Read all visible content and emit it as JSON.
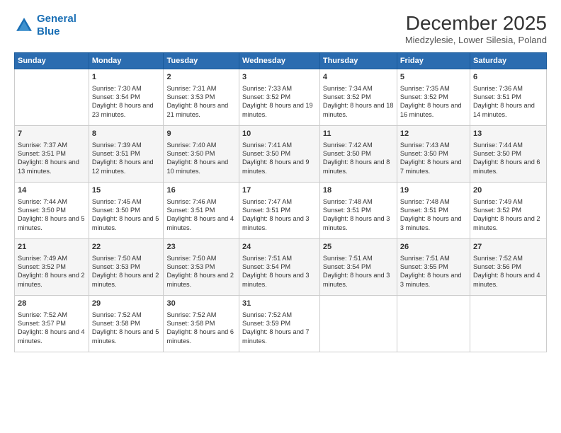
{
  "logo": {
    "line1": "General",
    "line2": "Blue"
  },
  "title": "December 2025",
  "subtitle": "Miedzylesie, Lower Silesia, Poland",
  "weekdays": [
    "Sunday",
    "Monday",
    "Tuesday",
    "Wednesday",
    "Thursday",
    "Friday",
    "Saturday"
  ],
  "weeks": [
    [
      {
        "day": "",
        "sunrise": "",
        "sunset": "",
        "daylight": ""
      },
      {
        "day": "1",
        "sunrise": "Sunrise: 7:30 AM",
        "sunset": "Sunset: 3:54 PM",
        "daylight": "Daylight: 8 hours and 23 minutes."
      },
      {
        "day": "2",
        "sunrise": "Sunrise: 7:31 AM",
        "sunset": "Sunset: 3:53 PM",
        "daylight": "Daylight: 8 hours and 21 minutes."
      },
      {
        "day": "3",
        "sunrise": "Sunrise: 7:33 AM",
        "sunset": "Sunset: 3:52 PM",
        "daylight": "Daylight: 8 hours and 19 minutes."
      },
      {
        "day": "4",
        "sunrise": "Sunrise: 7:34 AM",
        "sunset": "Sunset: 3:52 PM",
        "daylight": "Daylight: 8 hours and 18 minutes."
      },
      {
        "day": "5",
        "sunrise": "Sunrise: 7:35 AM",
        "sunset": "Sunset: 3:52 PM",
        "daylight": "Daylight: 8 hours and 16 minutes."
      },
      {
        "day": "6",
        "sunrise": "Sunrise: 7:36 AM",
        "sunset": "Sunset: 3:51 PM",
        "daylight": "Daylight: 8 hours and 14 minutes."
      }
    ],
    [
      {
        "day": "7",
        "sunrise": "Sunrise: 7:37 AM",
        "sunset": "Sunset: 3:51 PM",
        "daylight": "Daylight: 8 hours and 13 minutes."
      },
      {
        "day": "8",
        "sunrise": "Sunrise: 7:39 AM",
        "sunset": "Sunset: 3:51 PM",
        "daylight": "Daylight: 8 hours and 12 minutes."
      },
      {
        "day": "9",
        "sunrise": "Sunrise: 7:40 AM",
        "sunset": "Sunset: 3:50 PM",
        "daylight": "Daylight: 8 hours and 10 minutes."
      },
      {
        "day": "10",
        "sunrise": "Sunrise: 7:41 AM",
        "sunset": "Sunset: 3:50 PM",
        "daylight": "Daylight: 8 hours and 9 minutes."
      },
      {
        "day": "11",
        "sunrise": "Sunrise: 7:42 AM",
        "sunset": "Sunset: 3:50 PM",
        "daylight": "Daylight: 8 hours and 8 minutes."
      },
      {
        "day": "12",
        "sunrise": "Sunrise: 7:43 AM",
        "sunset": "Sunset: 3:50 PM",
        "daylight": "Daylight: 8 hours and 7 minutes."
      },
      {
        "day": "13",
        "sunrise": "Sunrise: 7:44 AM",
        "sunset": "Sunset: 3:50 PM",
        "daylight": "Daylight: 8 hours and 6 minutes."
      }
    ],
    [
      {
        "day": "14",
        "sunrise": "Sunrise: 7:44 AM",
        "sunset": "Sunset: 3:50 PM",
        "daylight": "Daylight: 8 hours and 5 minutes."
      },
      {
        "day": "15",
        "sunrise": "Sunrise: 7:45 AM",
        "sunset": "Sunset: 3:50 PM",
        "daylight": "Daylight: 8 hours and 5 minutes."
      },
      {
        "day": "16",
        "sunrise": "Sunrise: 7:46 AM",
        "sunset": "Sunset: 3:51 PM",
        "daylight": "Daylight: 8 hours and 4 minutes."
      },
      {
        "day": "17",
        "sunrise": "Sunrise: 7:47 AM",
        "sunset": "Sunset: 3:51 PM",
        "daylight": "Daylight: 8 hours and 3 minutes."
      },
      {
        "day": "18",
        "sunrise": "Sunrise: 7:48 AM",
        "sunset": "Sunset: 3:51 PM",
        "daylight": "Daylight: 8 hours and 3 minutes."
      },
      {
        "day": "19",
        "sunrise": "Sunrise: 7:48 AM",
        "sunset": "Sunset: 3:51 PM",
        "daylight": "Daylight: 8 hours and 3 minutes."
      },
      {
        "day": "20",
        "sunrise": "Sunrise: 7:49 AM",
        "sunset": "Sunset: 3:52 PM",
        "daylight": "Daylight: 8 hours and 2 minutes."
      }
    ],
    [
      {
        "day": "21",
        "sunrise": "Sunrise: 7:49 AM",
        "sunset": "Sunset: 3:52 PM",
        "daylight": "Daylight: 8 hours and 2 minutes."
      },
      {
        "day": "22",
        "sunrise": "Sunrise: 7:50 AM",
        "sunset": "Sunset: 3:53 PM",
        "daylight": "Daylight: 8 hours and 2 minutes."
      },
      {
        "day": "23",
        "sunrise": "Sunrise: 7:50 AM",
        "sunset": "Sunset: 3:53 PM",
        "daylight": "Daylight: 8 hours and 2 minutes."
      },
      {
        "day": "24",
        "sunrise": "Sunrise: 7:51 AM",
        "sunset": "Sunset: 3:54 PM",
        "daylight": "Daylight: 8 hours and 3 minutes."
      },
      {
        "day": "25",
        "sunrise": "Sunrise: 7:51 AM",
        "sunset": "Sunset: 3:54 PM",
        "daylight": "Daylight: 8 hours and 3 minutes."
      },
      {
        "day": "26",
        "sunrise": "Sunrise: 7:51 AM",
        "sunset": "Sunset: 3:55 PM",
        "daylight": "Daylight: 8 hours and 3 minutes."
      },
      {
        "day": "27",
        "sunrise": "Sunrise: 7:52 AM",
        "sunset": "Sunset: 3:56 PM",
        "daylight": "Daylight: 8 hours and 4 minutes."
      }
    ],
    [
      {
        "day": "28",
        "sunrise": "Sunrise: 7:52 AM",
        "sunset": "Sunset: 3:57 PM",
        "daylight": "Daylight: 8 hours and 4 minutes."
      },
      {
        "day": "29",
        "sunrise": "Sunrise: 7:52 AM",
        "sunset": "Sunset: 3:58 PM",
        "daylight": "Daylight: 8 hours and 5 minutes."
      },
      {
        "day": "30",
        "sunrise": "Sunrise: 7:52 AM",
        "sunset": "Sunset: 3:58 PM",
        "daylight": "Daylight: 8 hours and 6 minutes."
      },
      {
        "day": "31",
        "sunrise": "Sunrise: 7:52 AM",
        "sunset": "Sunset: 3:59 PM",
        "daylight": "Daylight: 8 hours and 7 minutes."
      },
      {
        "day": "",
        "sunrise": "",
        "sunset": "",
        "daylight": ""
      },
      {
        "day": "",
        "sunrise": "",
        "sunset": "",
        "daylight": ""
      },
      {
        "day": "",
        "sunrise": "",
        "sunset": "",
        "daylight": ""
      }
    ]
  ]
}
